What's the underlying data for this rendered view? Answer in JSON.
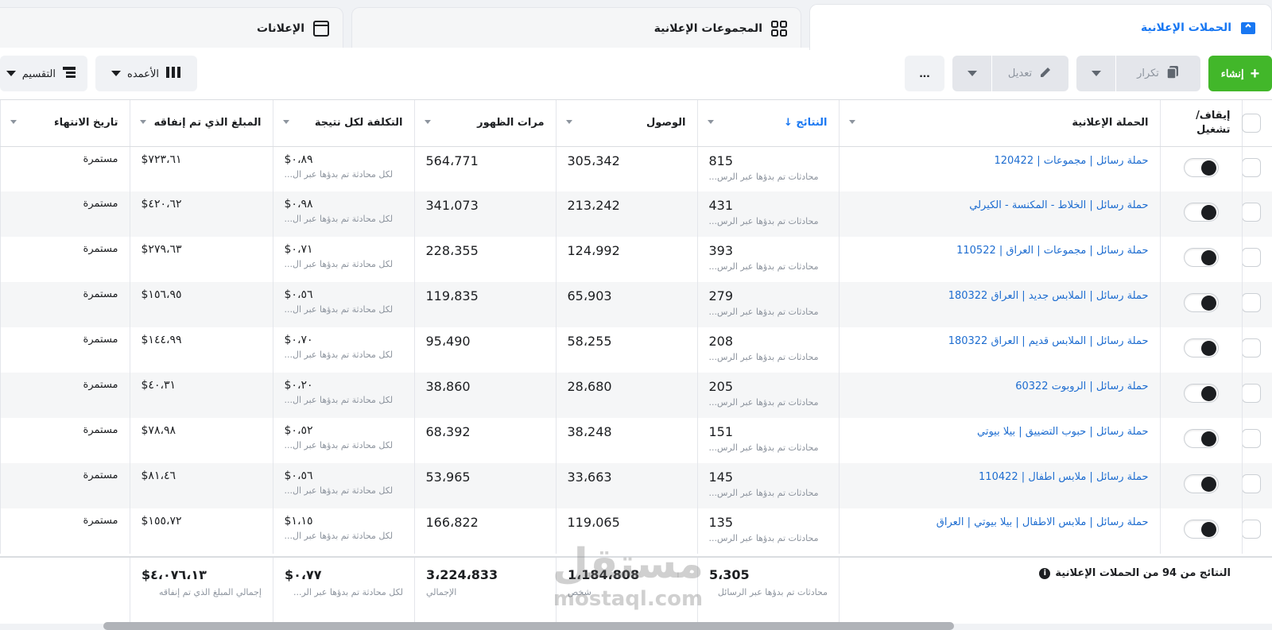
{
  "tabs": [
    {
      "label": "الحملات الإعلانية",
      "icon": "folder-icon"
    },
    {
      "label": "المجموعات الإعلانية",
      "icon": "grid-icon"
    },
    {
      "label": "الإعلانات",
      "icon": "ad-icon"
    }
  ],
  "toolbar": {
    "create_label": "إنشاء",
    "duplicate_label": "تكرار",
    "edit_label": "تعديل",
    "more_label": "...",
    "columns_label": "الأعمده",
    "breakdown_label": "التقسيم"
  },
  "columns": {
    "toggle": "إيقاف/ تشغيل",
    "campaign": "الحملة الإعلانية",
    "results": "النتائج ↓",
    "reach": "الوصول",
    "impressions": "مرات الظهور",
    "cost": "التكلفة لكل نتيجة",
    "spent": "المبلغ الذي تم إنفاقه",
    "end": "تاريخ الانتهاء"
  },
  "result_sub": "محادثات تم بدؤها عبر الرس...",
  "cost_sub": "لكل محادثة تم بدؤها عبر ال...",
  "rows": [
    {
      "campaign": "حملة رسائل | مجموعات | 120422",
      "results": "815",
      "reach": "305،342",
      "impressions": "564،771",
      "cost": "$٠،٨٩",
      "spent": "$٧٢٣،٦١",
      "end": "مستمرة"
    },
    {
      "campaign": "حملة رسائل | الخلاط - المكنسة - الكيرلي",
      "results": "431",
      "reach": "213،242",
      "impressions": "341،073",
      "cost": "$٠،٩٨",
      "spent": "$٤٢٠،٦٢",
      "end": "مستمرة"
    },
    {
      "campaign": "حملة رسائل | مجموعات | العراق | 110522",
      "results": "393",
      "reach": "124،992",
      "impressions": "228،355",
      "cost": "$٠،٧١",
      "spent": "$٢٧٩،٦٣",
      "end": "مستمرة"
    },
    {
      "campaign": "حملة رسائل | الملابس جديد | العراق 180322",
      "results": "279",
      "reach": "65،903",
      "impressions": "119،835",
      "cost": "$٠،٥٦",
      "spent": "$١٥٦،٩٥",
      "end": "مستمرة"
    },
    {
      "campaign": "حملة رسائل | الملابس قديم | العراق 180322",
      "results": "208",
      "reach": "58،255",
      "impressions": "95،490",
      "cost": "$٠،٧٠",
      "spent": "$١٤٤،٩٩",
      "end": "مستمرة"
    },
    {
      "campaign": "حملة رسائل | الروبوت 60322",
      "results": "205",
      "reach": "28،680",
      "impressions": "38،860",
      "cost": "$٠،٢٠",
      "spent": "$٤٠،٣١",
      "end": "مستمرة"
    },
    {
      "campaign": "حملة رسائل | حبوب التضييق | بيلا بيوتي",
      "results": "151",
      "reach": "38،248",
      "impressions": "68،392",
      "cost": "$٠،٥٢",
      "spent": "$٧٨،٩٨",
      "end": "مستمرة"
    },
    {
      "campaign": "حملة رسائل | ملابس اطفال | 110422",
      "results": "145",
      "reach": "33،663",
      "impressions": "53،965",
      "cost": "$٠،٥٦",
      "spent": "$٨١،٤٦",
      "end": "مستمرة"
    },
    {
      "campaign": "حملة رسائل | ملابس الاطفال | بيلا بيوتي | العراق",
      "results": "135",
      "reach": "119،065",
      "impressions": "166،822",
      "cost": "$١،١٥",
      "spent": "$١٥٥،٧٢",
      "end": "مستمرة"
    }
  ],
  "totals": {
    "title": "النتائج من 94 من الحملات الإعلانية",
    "results": "5،305",
    "results_sub": "محادثات تم بدؤها عبر الرسائل",
    "reach": "1،184،808",
    "reach_sub": "شخص",
    "impressions": "3،224،833",
    "impressions_sub": "الإجمالي",
    "cost": "$٠،٧٧",
    "cost_sub": "لكل محادثة تم بدؤها عبر الر...",
    "spent": "$٤،٠٧٦،١٣",
    "spent_sub": "إجمالي المبلغ الذي تم إنفاقه"
  },
  "watermark": {
    "line1": "مستقل",
    "line2": "mostaql.com"
  },
  "colors": {
    "accent": "#1877f2",
    "create": "#42b72a",
    "link": "#1e6dd0"
  }
}
